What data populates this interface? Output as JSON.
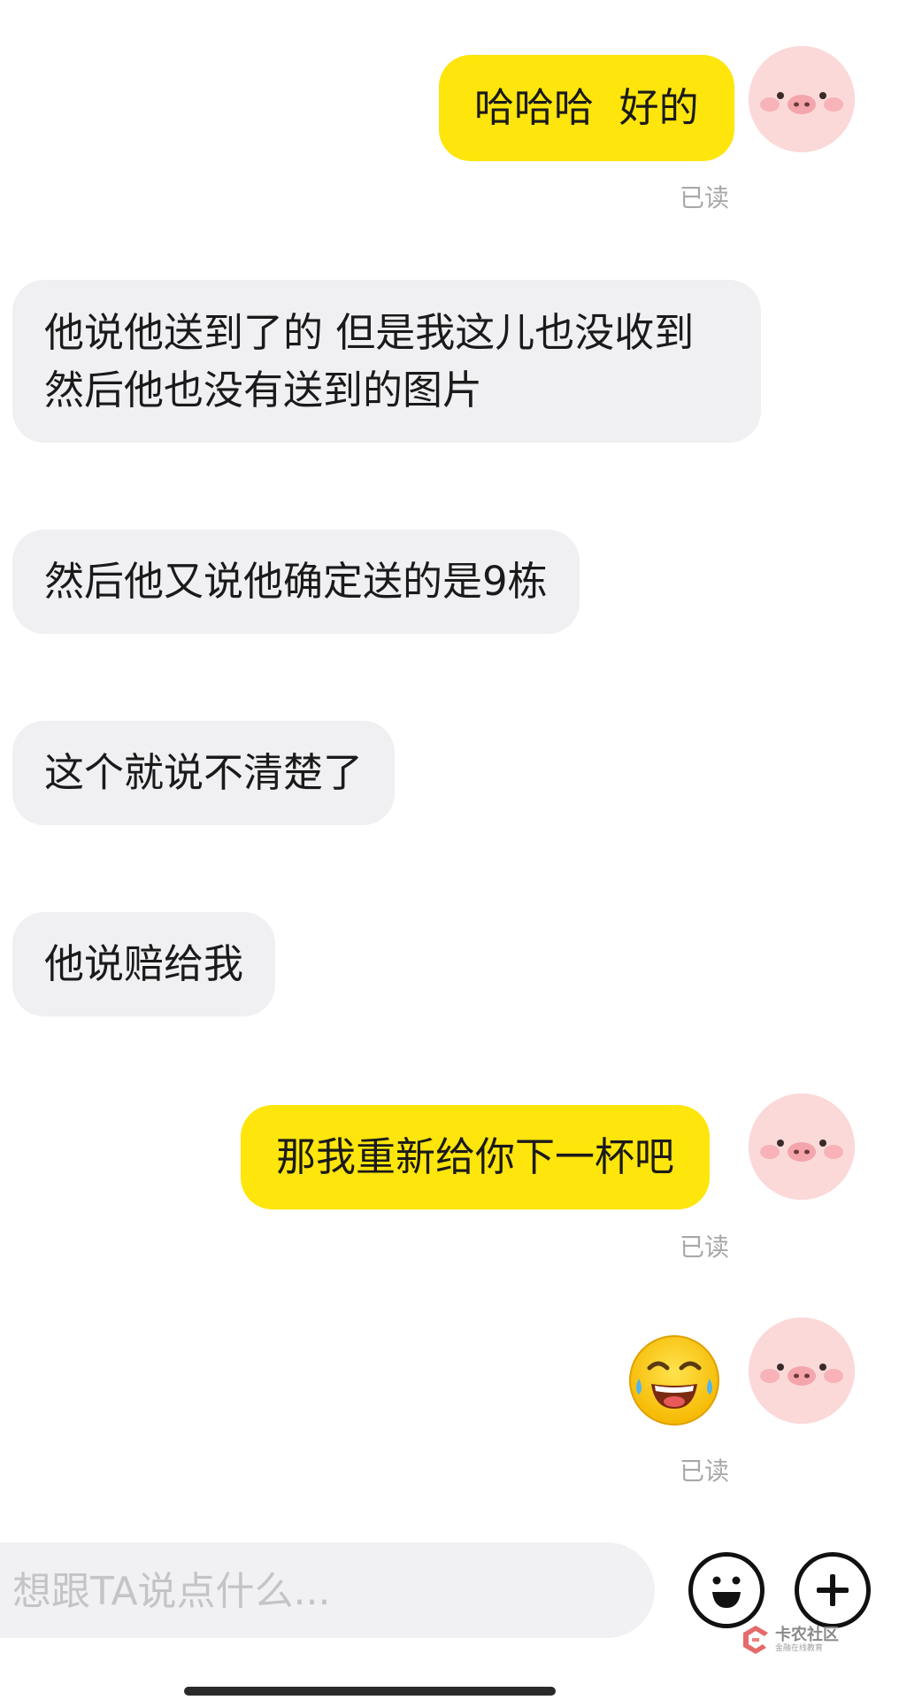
{
  "messages": [
    {
      "side": "mine",
      "text": "哈哈哈  好的",
      "status": "已读"
    },
    {
      "side": "other",
      "text": "他说他送到了的 但是我这儿也没收到 然后他也没有送到的图片"
    },
    {
      "side": "other",
      "text": "然后他又说他确定送的是9栋"
    },
    {
      "side": "other",
      "text": "这个就说不清楚了"
    },
    {
      "side": "other",
      "text": "他说赔给我"
    },
    {
      "side": "mine",
      "text": "那我重新给你下一杯吧",
      "status": "已读"
    },
    {
      "side": "mine",
      "emoji": "tears-of-joy-emoji",
      "status": "已读"
    }
  ],
  "input": {
    "placeholder": "想跟TA说点什么..."
  },
  "watermark": {
    "title": "卡农社区",
    "subtitle": "金融在线教育"
  },
  "colors": {
    "mine_bubble": "#fee50b",
    "other_bubble": "#f0f0f3",
    "avatar": "#fbd9d9",
    "read_text": "#a8a8a8"
  }
}
